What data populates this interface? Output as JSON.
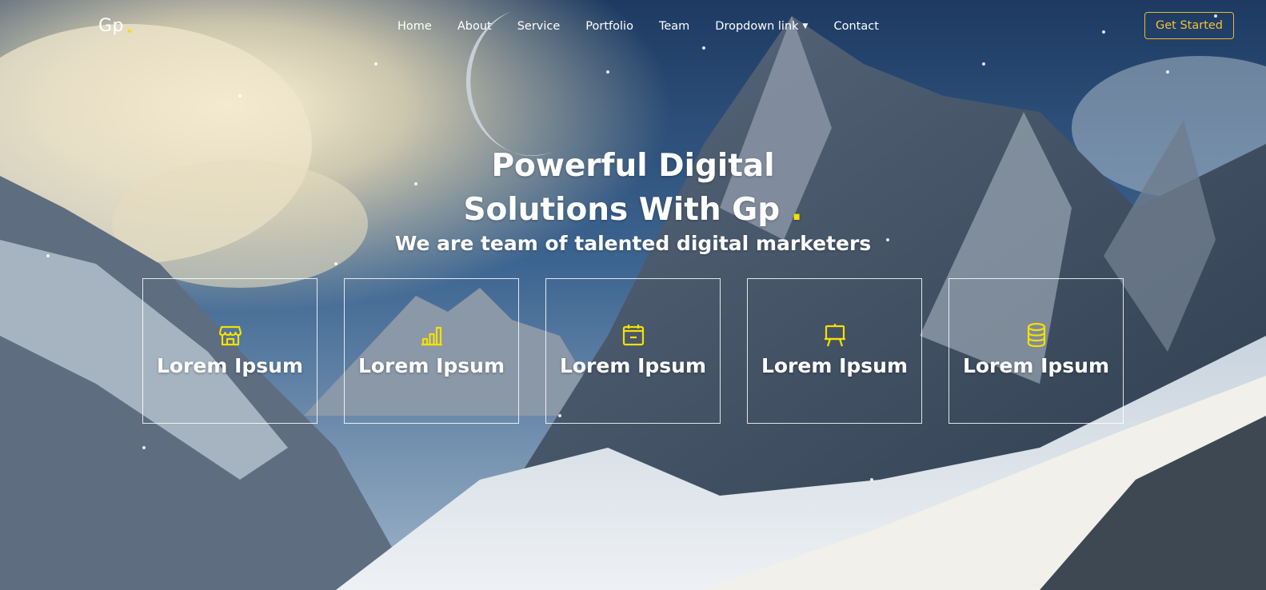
{
  "colors": {
    "accent": "#f5e000",
    "cta_text": "#f2c23a",
    "cta_border": "#e8b93a",
    "text": "#ffffff"
  },
  "brand": {
    "name": "Gp"
  },
  "nav": {
    "items": [
      {
        "label": "Home"
      },
      {
        "label": "About"
      },
      {
        "label": "Service"
      },
      {
        "label": "Portfolio"
      },
      {
        "label": "Team"
      },
      {
        "label": "Dropdown link",
        "dropdown": true
      },
      {
        "label": "Contact"
      }
    ],
    "cta_label": "Get Started"
  },
  "hero": {
    "title_line1": "Powerful Digital",
    "title_line2": "Solutions With Gp",
    "subtitle": "We are team of talented digital marketers"
  },
  "features": [
    {
      "icon": "store-icon",
      "label": "Lorem Ipsum"
    },
    {
      "icon": "bar-chart-icon",
      "label": "Lorem Ipsum"
    },
    {
      "icon": "calendar-icon",
      "label": "Lorem Ipsum"
    },
    {
      "icon": "presentation-icon",
      "label": "Lorem Ipsum"
    },
    {
      "icon": "database-icon",
      "label": "Lorem Ipsum"
    }
  ]
}
